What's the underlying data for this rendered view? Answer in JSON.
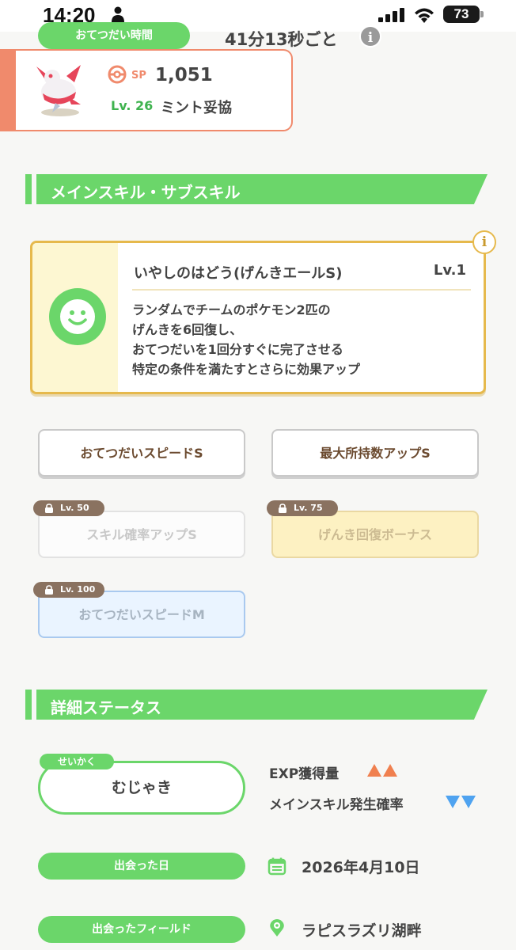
{
  "status_bar": {
    "time": "14:20",
    "battery": "73"
  },
  "helper": {
    "label": "おてつだい時間",
    "value": "41分13秒ごと",
    "info_icon": "i"
  },
  "pokemon": {
    "sp_label": "SP",
    "sp_value": "1,051",
    "level": "Lv. 26",
    "mint": "ミント妥協",
    "accent_color": "#f08a6c"
  },
  "skills_section": {
    "title": "メインスキル・サブスキル"
  },
  "main_skill": {
    "name": "いやしのはどう(げんきエールS)",
    "level": "Lv.1",
    "description": [
      "ランダムでチームのポケモン2匹の",
      "げんきを6回復し、",
      "おてつだいを1回分すぐに完了させる",
      "特定の条件を満たすとさらに効果アップ"
    ],
    "icon": "smile-icon",
    "info_icon": "i"
  },
  "sub_skills": [
    {
      "label": "おてつだいスピードS",
      "locked": false
    },
    {
      "label": "最大所持数アップS",
      "locked": false
    },
    {
      "label": "スキル確率アップS",
      "locked": true,
      "unlock": "Lv. 50"
    },
    {
      "label": "げんき回復ボーナス",
      "locked": true,
      "unlock": "Lv. 75"
    },
    {
      "label": "おてつだいスピードM",
      "locked": true,
      "unlock": "Lv. 100"
    }
  ],
  "details_section": {
    "title": "詳細ステータス"
  },
  "nature": {
    "tag": "せいかく",
    "value": "むじゃき",
    "up_label": "EXP獲得量",
    "down_label": "メインスキル発生確率",
    "up_color": "#f0804f",
    "down_color": "#4fa3f0"
  },
  "met_date": {
    "label": "出会った日",
    "value": "2026年4月10日"
  },
  "met_field": {
    "label": "出会ったフィールド",
    "value": "ラピスラズリ湖畔"
  },
  "colors": {
    "accent_green": "#6bd66a",
    "skill_border": "#e6b94c"
  }
}
